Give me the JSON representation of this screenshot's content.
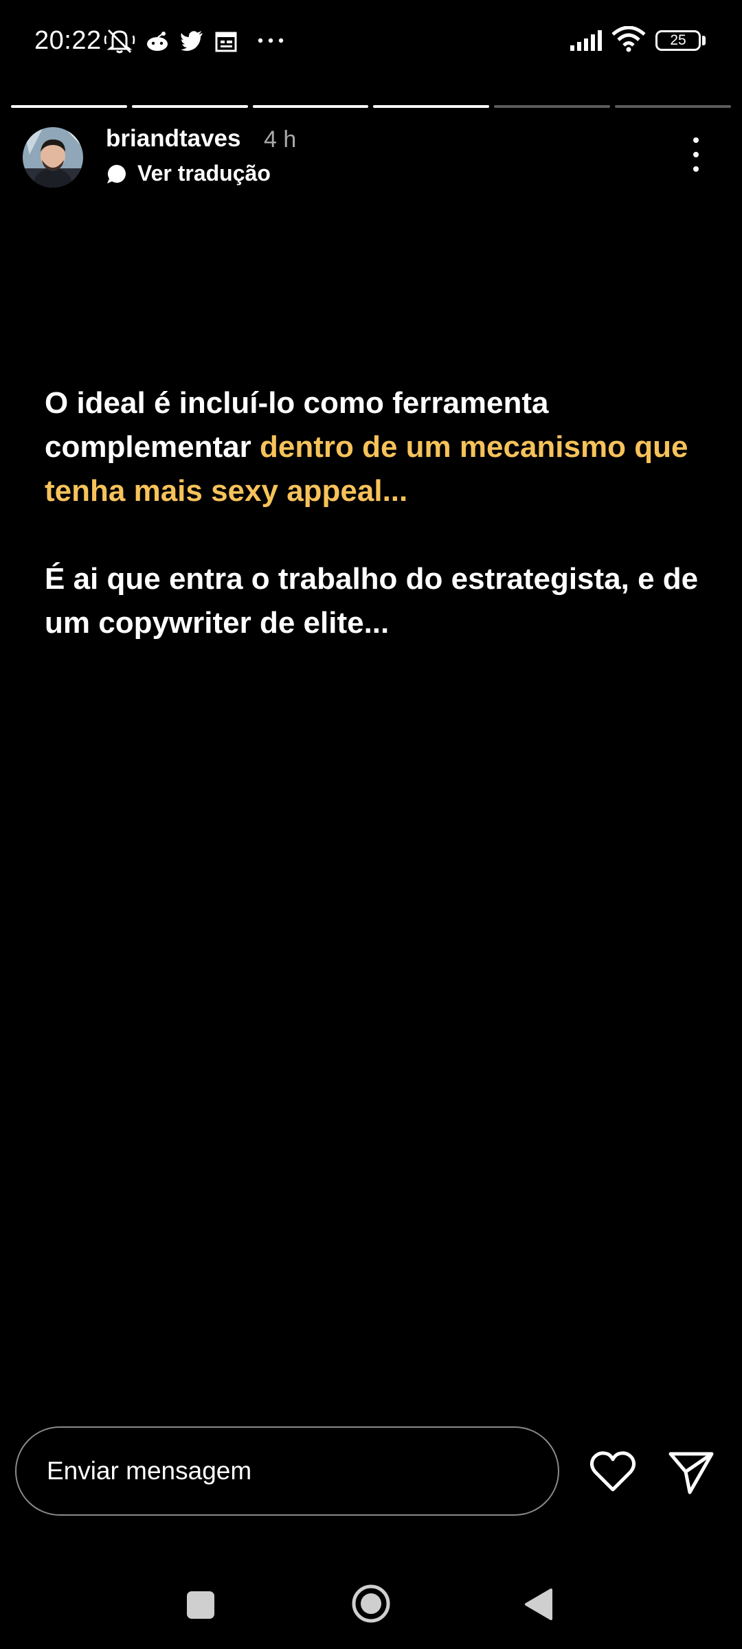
{
  "status_bar": {
    "time": "20:22",
    "icons": [
      "muted-bell-icon",
      "reddit-icon",
      "twitter-icon",
      "calendar-icon",
      "more-dots-icon"
    ],
    "right_icons": [
      "signal-icon",
      "wifi-icon"
    ],
    "battery": "25"
  },
  "story": {
    "progress": {
      "segments": 6,
      "completed": 4
    },
    "username": "briandtaves",
    "time_ago": "4 h",
    "translate_label": "Ver tradução",
    "text": {
      "p1_white": "O ideal é incluí-lo como ferramenta complementar ",
      "p1_yellow": "dentro de um mecanismo que tenha mais sexy appeal...",
      "p2": "É ai que entra o trabalho do estrategista, e de um copywriter de elite..."
    },
    "highlight_color": "#f6c25a"
  },
  "composer": {
    "placeholder": "Enviar mensagem"
  },
  "nav": {
    "buttons": [
      "recent-apps",
      "home",
      "back"
    ]
  }
}
